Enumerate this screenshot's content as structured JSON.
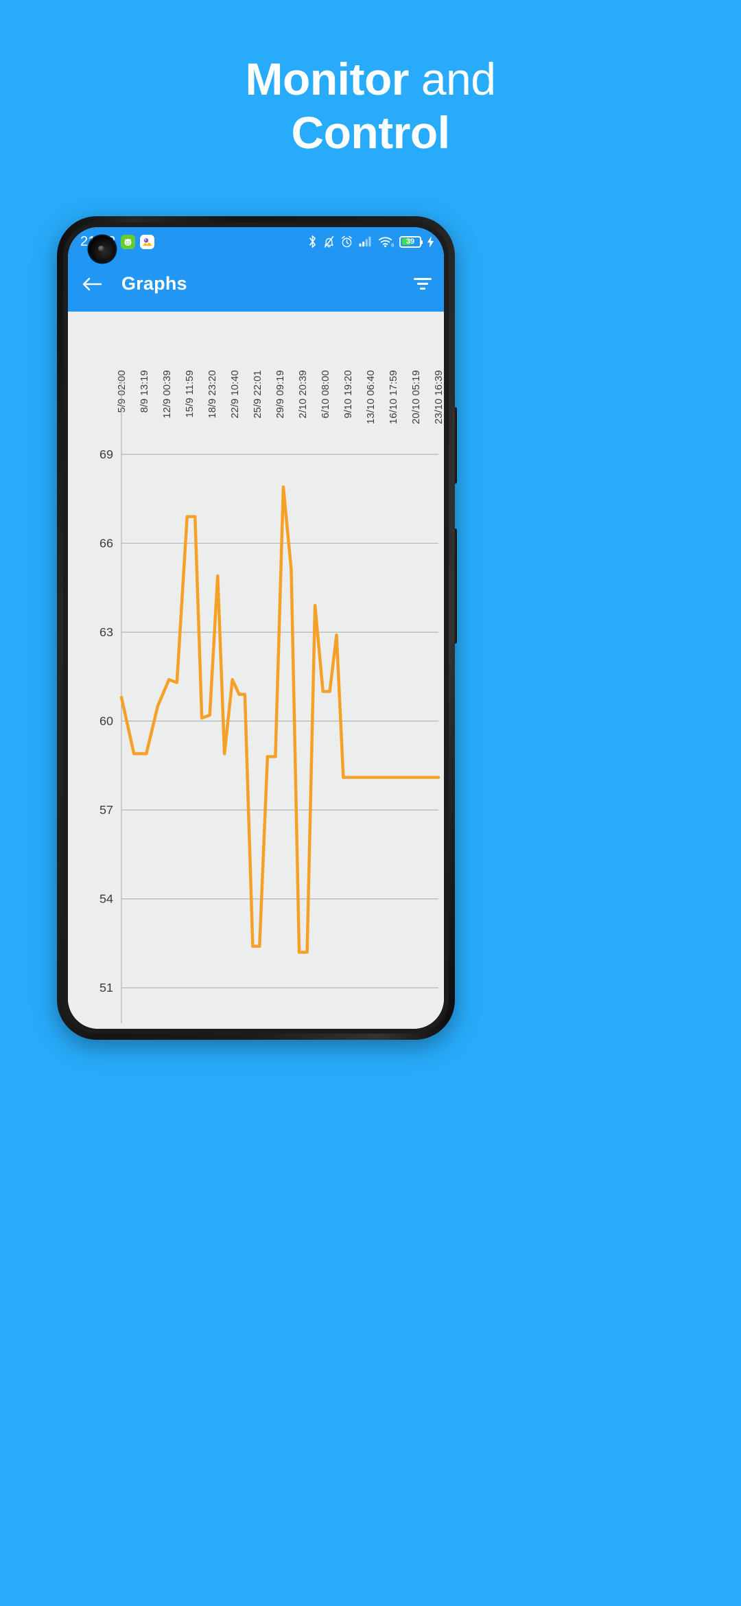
{
  "promo": {
    "line1_bold": "Monitor",
    "line1_rest": " and",
    "line2_bold": "Control"
  },
  "colors": {
    "brand_blue": "#28ABFA",
    "appbar_blue": "#2196F3",
    "chart_line": "#F5A027",
    "chart_bg": "#eceded",
    "grid": "#a8a8a8",
    "battery_green": "#3DDC52"
  },
  "statusbar": {
    "time": "21:22",
    "app_icons": [
      {
        "name": "green-robot-icon",
        "glyph": "◑"
      },
      {
        "name": "gallery-icon",
        "glyph": "◉"
      }
    ],
    "right_icons": [
      "bluetooth-icon",
      "mute-bell-icon",
      "alarm-icon",
      "cellular-signal-icon",
      "wifi6-icon",
      "battery-icon",
      "charging-bolt-icon"
    ],
    "wifi_generation": "6",
    "battery_percent": "39"
  },
  "appbar": {
    "back_label": "Back",
    "title": "Graphs",
    "filter_label": "Filter"
  },
  "chart_data": {
    "type": "line",
    "title": "Graphs",
    "xlabel": "",
    "ylabel": "",
    "grid": true,
    "legend": null,
    "ylim": [
      49.8,
      70.6
    ],
    "yticks": [
      69,
      66,
      63,
      60,
      57,
      54,
      51
    ],
    "xtick_labels": [
      "5/9 02:00",
      "8/9 13:19",
      "12/9 00:39",
      "15/9 11:59",
      "18/9 23:20",
      "22/9 10:40",
      "25/9 22:01",
      "29/9 09:19",
      "2/10 20:39",
      "6/10 08:00",
      "9/10 19:20",
      "13/10 06:40",
      "16/10 17:59",
      "20/10 05:19",
      "23/10 16:39"
    ],
    "x": [
      0.0,
      0.55,
      1.1,
      1.6,
      2.1,
      2.45,
      2.9,
      3.25,
      3.55,
      3.9,
      4.25,
      4.55,
      4.9,
      5.2,
      5.45,
      5.8,
      6.1,
      6.45,
      6.8,
      7.15,
      7.5,
      7.85,
      8.2,
      8.55,
      8.9,
      9.2,
      9.5,
      9.8,
      10.2,
      11.0,
      12.0,
      13.0,
      14.0
    ],
    "values": [
      60.8,
      58.9,
      58.9,
      60.5,
      61.4,
      61.3,
      66.9,
      66.9,
      60.1,
      60.2,
      64.9,
      58.9,
      61.4,
      60.9,
      60.9,
      52.4,
      52.4,
      58.8,
      58.8,
      67.9,
      65.1,
      52.2,
      52.2,
      63.9,
      61.0,
      61.0,
      62.9,
      58.1,
      58.1,
      58.1,
      58.1,
      58.1,
      58.1
    ]
  }
}
